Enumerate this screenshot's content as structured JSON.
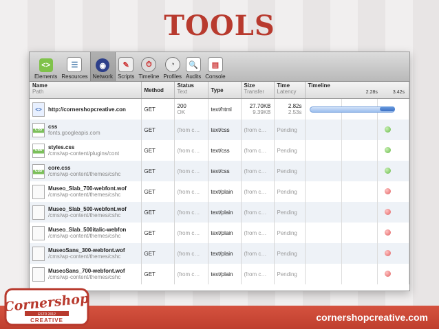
{
  "slide": {
    "title": "TOOLS",
    "footer_url": "cornershopcreative.com"
  },
  "logo": {
    "text": "Cornershop",
    "subtext": "CREATIVE",
    "est": "ESTD 2012"
  },
  "toolbar": {
    "items": [
      {
        "label": "Elements",
        "icon": "elements-icon",
        "selected": false
      },
      {
        "label": "Resources",
        "icon": "resources-icon",
        "selected": false
      },
      {
        "label": "Network",
        "icon": "network-icon",
        "selected": true
      },
      {
        "label": "Scripts",
        "icon": "scripts-icon",
        "selected": false
      },
      {
        "label": "Timeline",
        "icon": "timeline-icon",
        "selected": false
      },
      {
        "label": "Profiles",
        "icon": "profiles-icon",
        "selected": false
      },
      {
        "label": "Audits",
        "icon": "audits-icon",
        "selected": false
      },
      {
        "label": "Console",
        "icon": "console-icon",
        "selected": false
      }
    ]
  },
  "columns": {
    "name": "Name",
    "name_sub": "Path",
    "method": "Method",
    "status": "Status",
    "status_sub": "Text",
    "type": "Type",
    "size": "Size",
    "size_sub": "Transfer",
    "time": "Time",
    "time_sub": "Latency",
    "timeline": "Timeline",
    "tick1": "2.28s",
    "tick2": "3.42s"
  },
  "rows": [
    {
      "icon": "html",
      "name": "http://cornershopcreative.con",
      "path": "",
      "method": "GET",
      "status": "200",
      "status_text": "OK",
      "type": "text/html",
      "size": "27.70KB",
      "transfer": "9.39KB",
      "time": "2.82s",
      "latency": "2.53s",
      "state": "bar"
    },
    {
      "icon": "css",
      "name": "css",
      "path": "fonts.googleapis.com",
      "method": "GET",
      "status": "(from c…",
      "status_text": "",
      "type": "text/css",
      "size": "(from c…",
      "transfer": "",
      "time": "Pending",
      "latency": "",
      "state": "green"
    },
    {
      "icon": "css",
      "name": "styles.css",
      "path": "/cms/wp-content/plugins/cont",
      "method": "GET",
      "status": "(from c…",
      "status_text": "",
      "type": "text/css",
      "size": "(from c…",
      "transfer": "",
      "time": "Pending",
      "latency": "",
      "state": "green"
    },
    {
      "icon": "css",
      "name": "core.css",
      "path": "/cms/wp-content/themes/cshc",
      "method": "GET",
      "status": "(from c…",
      "status_text": "",
      "type": "text/css",
      "size": "(from c…",
      "transfer": "",
      "time": "Pending",
      "latency": "",
      "state": "green"
    },
    {
      "icon": "file",
      "name": "Museo_Slab_700-webfont.wof",
      "path": "/cms/wp-content/themes/cshc",
      "method": "GET",
      "status": "(from c…",
      "status_text": "",
      "type": "text/plain",
      "size": "(from c…",
      "transfer": "",
      "time": "Pending",
      "latency": "",
      "state": "red"
    },
    {
      "icon": "file",
      "name": "Museo_Slab_500-webfont.wof",
      "path": "/cms/wp-content/themes/cshc",
      "method": "GET",
      "status": "(from c…",
      "status_text": "",
      "type": "text/plain",
      "size": "(from c…",
      "transfer": "",
      "time": "Pending",
      "latency": "",
      "state": "red"
    },
    {
      "icon": "file",
      "name": "Museo_Slab_500italic-webfon",
      "path": "/cms/wp-content/themes/cshc",
      "method": "GET",
      "status": "(from c…",
      "status_text": "",
      "type": "text/plain",
      "size": "(from c…",
      "transfer": "",
      "time": "Pending",
      "latency": "",
      "state": "red"
    },
    {
      "icon": "file",
      "name": "MuseoSans_300-webfont.wof",
      "path": "/cms/wp-content/themes/cshc",
      "method": "GET",
      "status": "(from c…",
      "status_text": "",
      "type": "text/plain",
      "size": "(from c…",
      "transfer": "",
      "time": "Pending",
      "latency": "",
      "state": "red"
    },
    {
      "icon": "file",
      "name": "MuseoSans_700-webfont.wof",
      "path": "/cms/wp-content/themes/cshc",
      "method": "GET",
      "status": "(from c…",
      "status_text": "",
      "type": "text/plain",
      "size": "(from c…",
      "transfer": "",
      "time": "Pending",
      "latency": "",
      "state": "red"
    }
  ],
  "colors": {
    "accent": "#b83a2e",
    "footer": "#c8442f",
    "bar": "#4a7fd0",
    "ok": "#66b847",
    "error": "#e06060"
  }
}
